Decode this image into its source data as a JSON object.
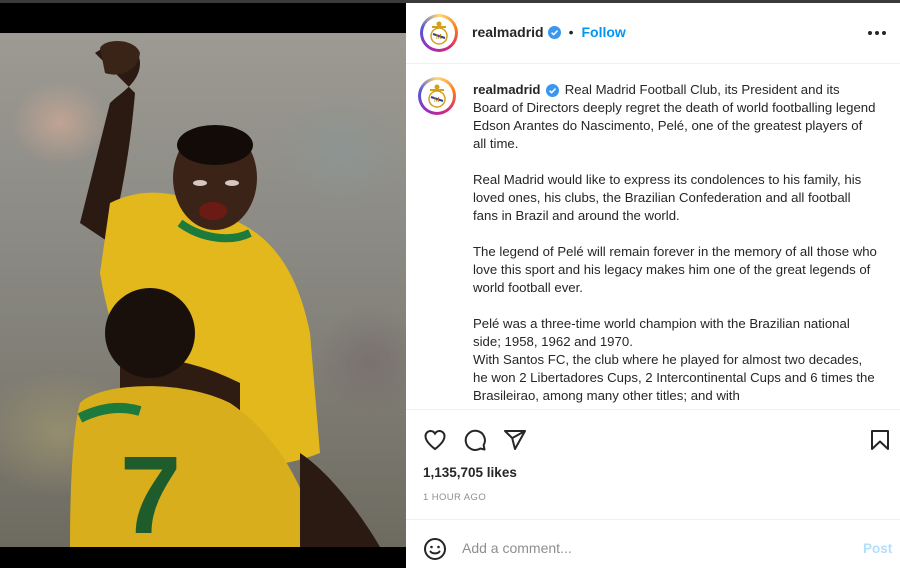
{
  "post": {
    "account": "realmadrid",
    "follow_label": "Follow",
    "caption": {
      "username": "realmadrid",
      "paragraphs": [
        "Real Madrid Football Club, its President and its Board of Directors deeply regret the death of world footballing legend Edson Arantes do Nascimento, Pelé, one of the greatest players of all time.",
        "Real Madrid would like to express its condolences to his family, his loved ones, his clubs, the Brazilian Confederation and all football fans in Brazil and around the world.",
        "The legend of Pelé will remain forever in the memory of all those who love this sport and his legacy makes him one of the great legends of world football ever.",
        "Pelé was a three-time world champion with the Brazilian national side; 1958, 1962 and 1970.",
        "With Santos FC, the club where he played for almost two decades, he won 2 Libertadores Cups, 2 Intercontinental Cups and 6 times the Brasileirao, among many other titles; and with"
      ]
    },
    "likes": "1,135,705 likes",
    "time": "1 HOUR AGO",
    "comment_placeholder": "Add a comment...",
    "post_label": "Post",
    "photo_jersey_number": "7"
  },
  "icons": {
    "like": "heart-icon",
    "comment": "comment-icon",
    "share": "paper-plane-icon",
    "save": "bookmark-icon",
    "emoji": "smiley-icon",
    "verified": "verified-badge-icon",
    "more": "more-options-icon"
  },
  "colors": {
    "accent": "#0095f6",
    "post_disabled": "#b2dffc",
    "muted": "#8e8e8e",
    "verified": "#3897f0"
  }
}
